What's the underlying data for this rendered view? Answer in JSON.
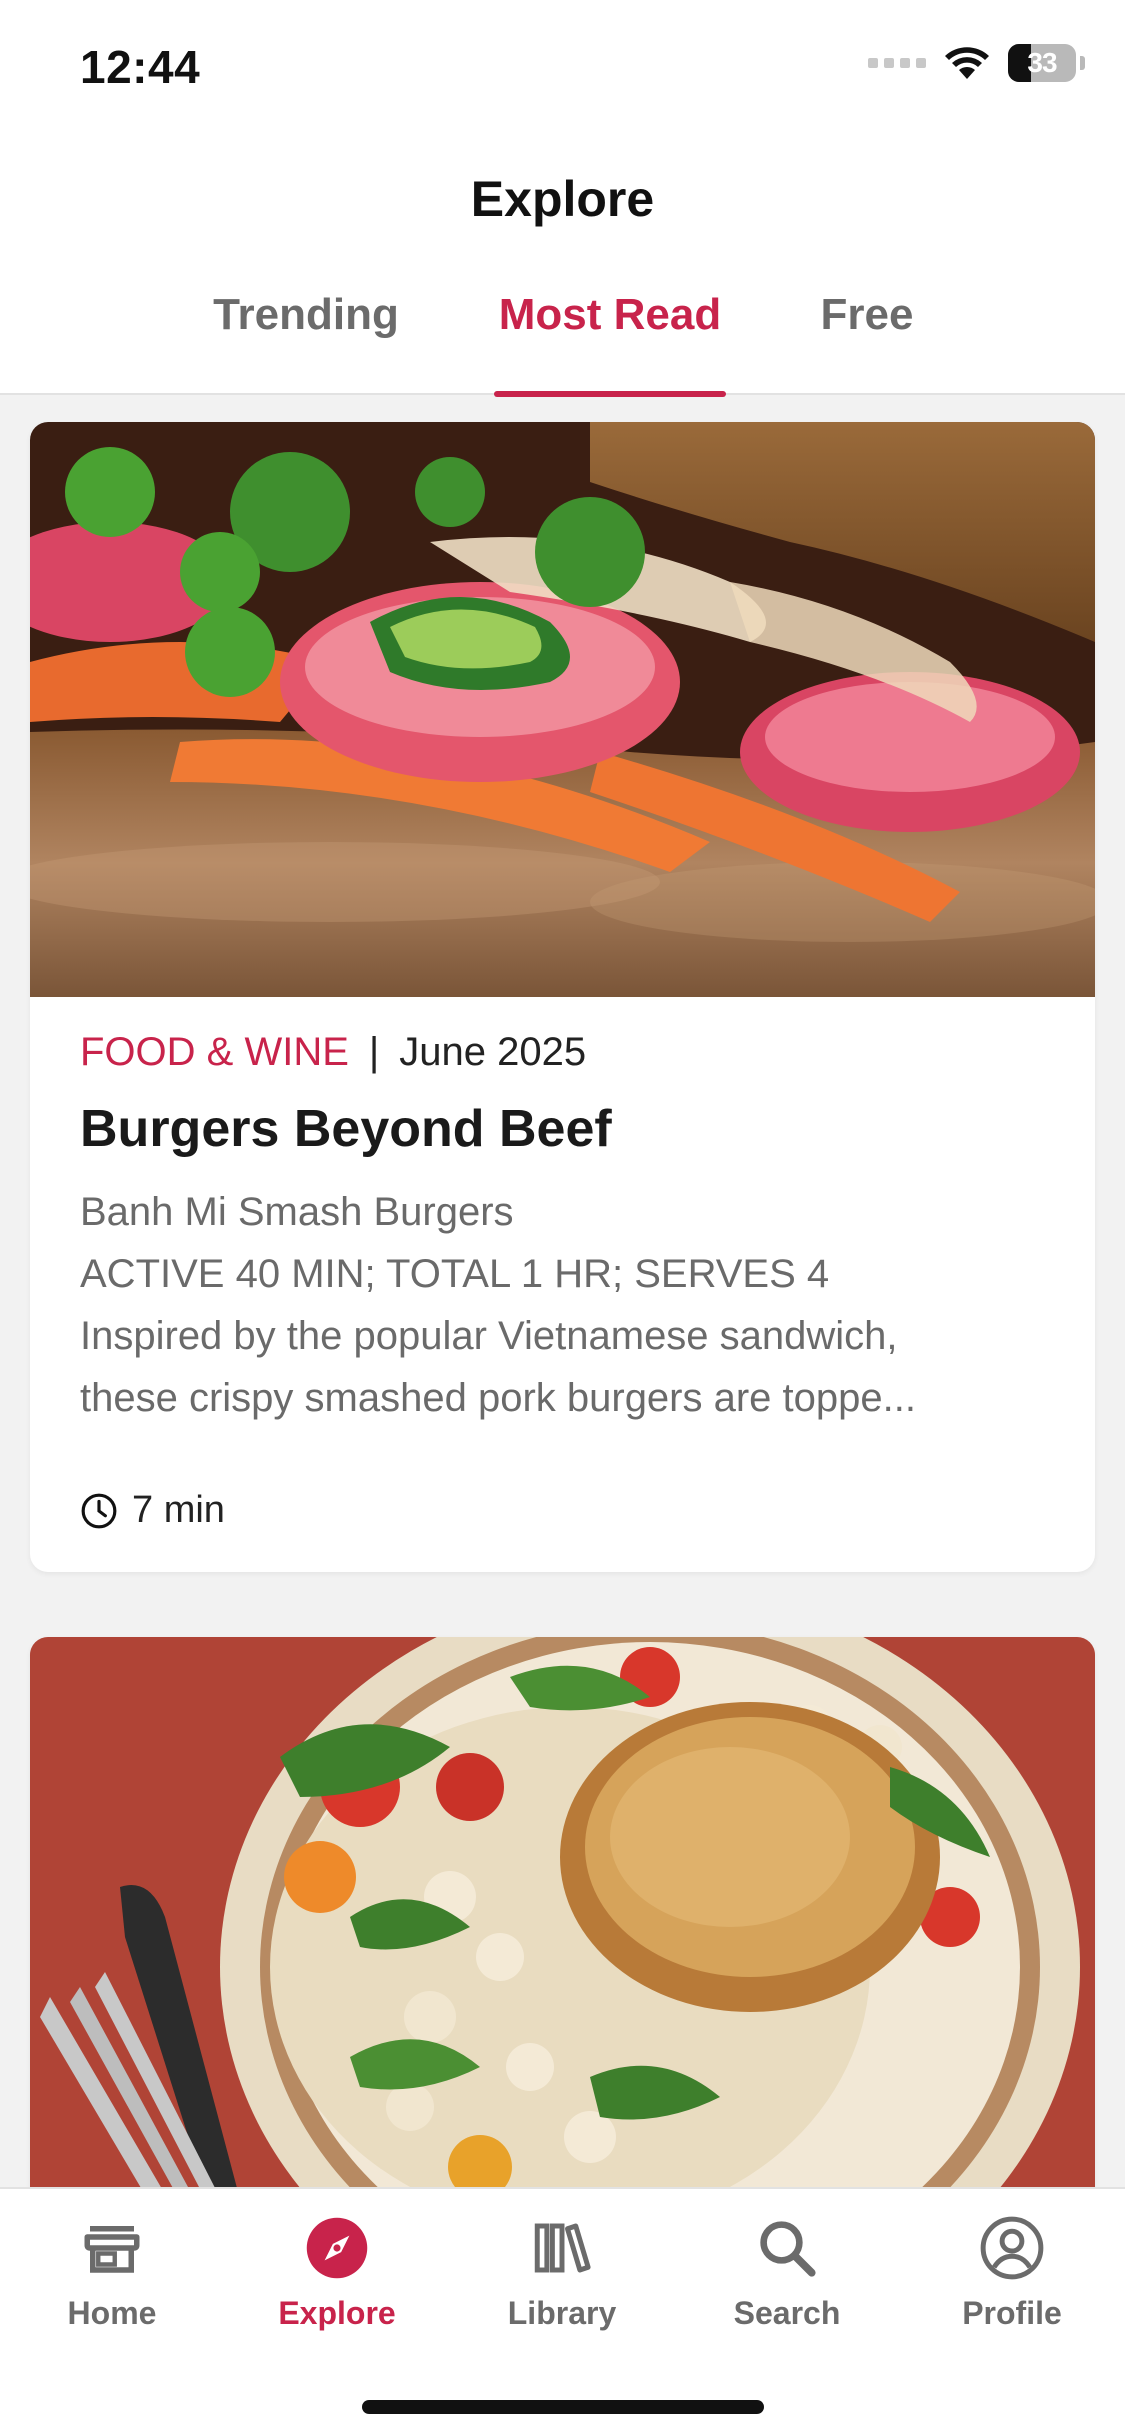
{
  "status_bar": {
    "time": "12:44",
    "battery_percent": "33",
    "battery_level": 0.33,
    "icons": [
      "signal-icon",
      "wifi-icon",
      "battery-icon"
    ]
  },
  "header": {
    "title": "Explore",
    "tabs": [
      {
        "label": "Trending",
        "active": false
      },
      {
        "label": "Most Read",
        "active": true
      },
      {
        "label": "Free",
        "active": false
      }
    ]
  },
  "feed": {
    "cards": [
      {
        "image": "banh-mi-smash-burger-photo",
        "source": "FOOD & WINE",
        "separator": "|",
        "date": "June 2025",
        "title": "Burgers Beyond Beef",
        "excerpt_lines": [
          "Banh Mi Smash Burgers",
          "ACTIVE 40 MIN; TOTAL 1 HR; SERVES 4",
          "Inspired by the popular Vietnamese sandwich,",
          "these crispy smashed pork burgers are toppe..."
        ],
        "read_time": "7 min",
        "read_time_icon": "clock-icon"
      },
      {
        "image": "chicken-white-beans-salad-photo"
      }
    ]
  },
  "tab_bar": {
    "items": [
      {
        "label": "Home",
        "icon": "store-icon",
        "active": false
      },
      {
        "label": "Explore",
        "icon": "compass-icon",
        "active": true
      },
      {
        "label": "Library",
        "icon": "books-icon",
        "active": false
      },
      {
        "label": "Search",
        "icon": "search-icon",
        "active": false
      },
      {
        "label": "Profile",
        "icon": "profile-icon",
        "active": false
      }
    ]
  },
  "colors": {
    "accent": "#c8234b",
    "inactive": "#6b6b6b",
    "background": "#f2f2f2",
    "card": "#ffffff"
  }
}
